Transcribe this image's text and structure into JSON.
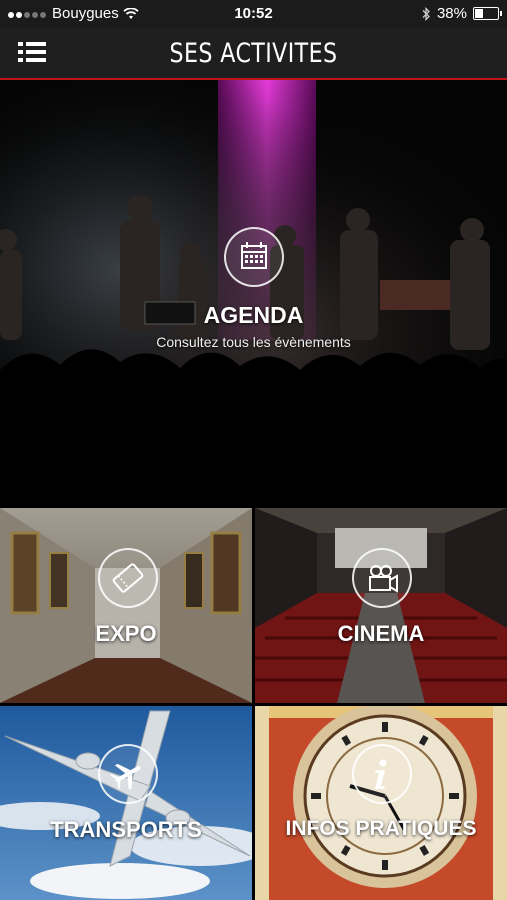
{
  "status_bar": {
    "carrier": "Bouygues",
    "time": "10:52",
    "battery_percent_label": "38%",
    "battery_level": 0.38
  },
  "nav": {
    "title": "SES ACTIVITES"
  },
  "hero": {
    "title": "AGENDA",
    "subtitle": "Consultez tous les évènements",
    "icon": "calendar-icon"
  },
  "tiles": [
    {
      "label": "EXPO",
      "icon": "ticket-icon"
    },
    {
      "label": "CINEMA",
      "icon": "movie-camera-icon"
    },
    {
      "label": "TRANSPORTS",
      "icon": "airplane-icon"
    },
    {
      "label": "INFOS PRATIQUES",
      "icon": "info-icon"
    }
  ],
  "colors": {
    "accent": "#c0161b",
    "nav_bg": "#1f1f1f"
  }
}
